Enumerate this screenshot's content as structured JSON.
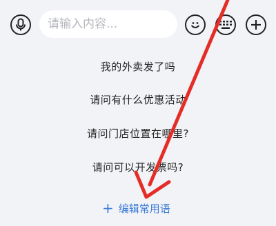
{
  "input_bar": {
    "placeholder": "请输入内容...",
    "icons": {
      "voice": "microphone-icon",
      "emoji": "smile-icon",
      "keyboard": "keyboard-icon",
      "more": "plus-icon"
    }
  },
  "quick_phrases": [
    "我的外卖发了吗",
    "请问有什么优惠活动",
    "请问门店位置在哪里?",
    "请问可以开发票吗?"
  ],
  "edit_phrases": {
    "icon": "+",
    "label": "编辑常用语"
  },
  "colors": {
    "background": "#f2f3f7",
    "accent": "#3a7bd5",
    "annotation_arrow": "#e52d27"
  }
}
